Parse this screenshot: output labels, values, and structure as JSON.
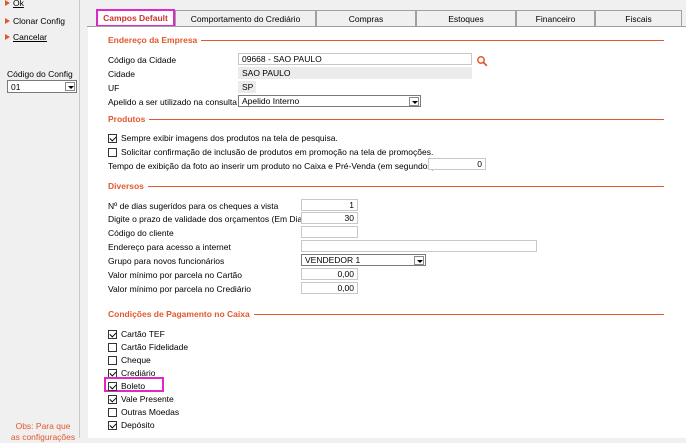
{
  "sidebar": {
    "ok_label": "Ok",
    "clonar_label": "Clonar Config",
    "cancelar_label": "Cancelar",
    "codigo_label": "Código do Config",
    "codigo_value": "01",
    "obs_text": "Obs: Para que as configurações"
  },
  "tabs": [
    {
      "label": "Campos Default",
      "active": true
    },
    {
      "label": "Comportamento do Crediário"
    },
    {
      "label": "Compras"
    },
    {
      "label": "Estoques"
    },
    {
      "label": "Financeiro"
    },
    {
      "label": "Fiscais"
    }
  ],
  "endereco": {
    "title": "Endereço da Empresa",
    "codigo_cidade_label": "Código da Cidade",
    "codigo_cidade_value": "09668 - SAO PAULO",
    "cidade_label": "Cidade",
    "cidade_value": "SAO PAULO",
    "uf_label": "UF",
    "uf_value": "SP",
    "apelido_label": "Apelido a ser utilizado na consulta",
    "apelido_value": "Apelido Interno"
  },
  "produtos": {
    "title": "Produtos",
    "opt1_label": "Sempre exibir imagens dos produtos na tela de pesquisa.",
    "opt1_checked": true,
    "opt2_label": "Solicitar confirmação de inclusão de produtos em promoção na tela de promoções.",
    "opt2_checked": false,
    "tempo_label": "Tempo de exibição da foto ao inserir um produto no Caixa e Pré-Venda (em segundos):",
    "tempo_value": "0"
  },
  "diversos": {
    "title": "Diversos",
    "dias_label": "Nº de dias sugeridos para os cheques a vista",
    "dias_value": "1",
    "prazo_label": "Digite o prazo de validade dos orçamentos (Em Dias)",
    "prazo_value": "30",
    "cliente_label": "Código do cliente",
    "cliente_value": "",
    "endereco_label": "Endereço para acesso a internet",
    "endereco_value": "",
    "grupo_label": "Grupo para novos funcionários",
    "grupo_value": "VENDEDOR 1",
    "cartao_label": "Valor mínimo por parcela no Cartão",
    "cartao_value": "0,00",
    "crediario_label": "Valor mínimo por parcela no Crediário",
    "crediario_value": "0,00"
  },
  "pagamento": {
    "title": "Condições de Pagamento no Caixa",
    "items": [
      {
        "label": "Cartão TEF",
        "checked": true
      },
      {
        "label": "Cartão Fidelidade",
        "checked": false
      },
      {
        "label": "Cheque",
        "checked": false
      },
      {
        "label": "Crediário",
        "checked": true
      },
      {
        "label": "Boleto",
        "checked": true
      },
      {
        "label": "Vale Presente",
        "checked": true
      },
      {
        "label": "Outras Moedas",
        "checked": false
      },
      {
        "label": "Depósito",
        "checked": true
      }
    ]
  },
  "colors": {
    "accent": "#e2572c",
    "highlight": "#e028c8"
  }
}
